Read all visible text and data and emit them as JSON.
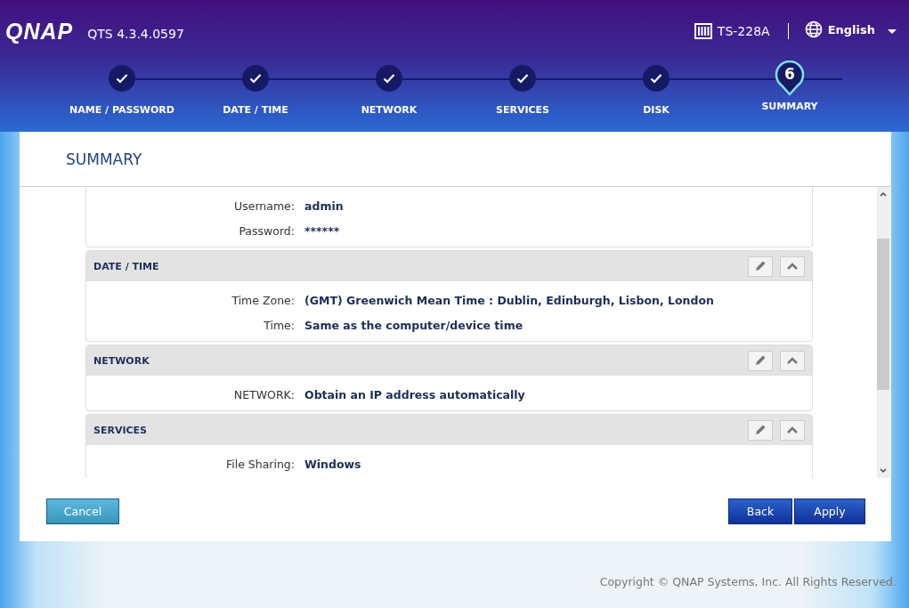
{
  "header": {
    "logo": "QNAP",
    "version": "QTS 4.3.4.0597",
    "device": "TS-228A",
    "language": "English"
  },
  "steps": [
    {
      "label": "NAME / PASSWORD",
      "kind": "done"
    },
    {
      "label": "DATE / TIME",
      "kind": "done"
    },
    {
      "label": "NETWORK",
      "kind": "done"
    },
    {
      "label": "SERVICES",
      "kind": "done"
    },
    {
      "label": "DISK",
      "kind": "done"
    },
    {
      "label": "SUMMARY",
      "kind": "current",
      "number": "6"
    }
  ],
  "panel": {
    "title": "SUMMARY"
  },
  "sections": [
    {
      "fields": [
        {
          "label": "Username:",
          "value": "admin"
        },
        {
          "label": "Password:",
          "value": "******"
        }
      ]
    },
    {
      "title": "DATE / TIME",
      "fields": [
        {
          "label": "Time Zone:",
          "value": "(GMT) Greenwich Mean Time : Dublin, Edinburgh, Lisbon, London"
        },
        {
          "label": "Time:",
          "value": "Same as the computer/device time"
        }
      ]
    },
    {
      "title": "NETWORK",
      "fields": [
        {
          "label": "NETWORK:",
          "value": "Obtain an IP address automatically"
        }
      ]
    },
    {
      "title": "SERVICES",
      "fields": [
        {
          "label": "File Sharing:",
          "value": "Windows"
        }
      ]
    }
  ],
  "buttons": {
    "cancel": "Cancel",
    "back": "Back",
    "apply": "Apply"
  },
  "copyright": "Copyright © QNAP Systems, Inc. All Rights Reserved."
}
